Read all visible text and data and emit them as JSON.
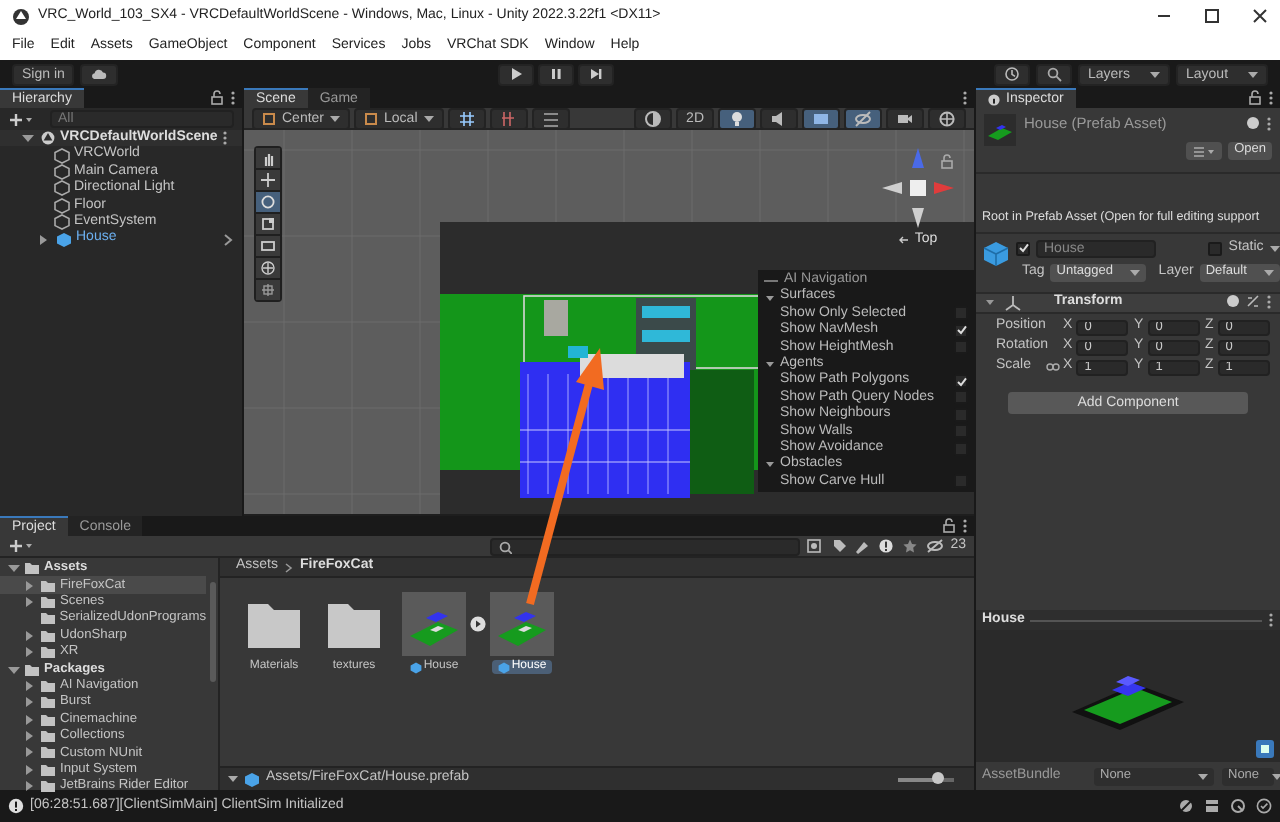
{
  "window": {
    "title": "VRC_World_103_SX4 - VRCDefaultWorldScene - Windows, Mac, Linux - Unity 2022.3.22f1 <DX11>"
  },
  "menu": [
    "File",
    "Edit",
    "Assets",
    "GameObject",
    "Component",
    "Services",
    "Jobs",
    "VRChat SDK",
    "Window",
    "Help"
  ],
  "toolbar": {
    "sign_in": "Sign in",
    "layers": "Layers",
    "layout": "Layout"
  },
  "hierarchy": {
    "tab": "Hierarchy",
    "search_placeholder": "All",
    "scene": {
      "name": "VRCDefaultWorldScene",
      "expanded": true
    },
    "objects": [
      {
        "name": "VRCWorld",
        "kind": "object"
      },
      {
        "name": "Main Camera",
        "kind": "object"
      },
      {
        "name": "Directional Light",
        "kind": "object"
      },
      {
        "name": "Floor",
        "kind": "object"
      },
      {
        "name": "EventSystem",
        "kind": "object"
      },
      {
        "name": "House",
        "kind": "prefab"
      }
    ]
  },
  "scene_view": {
    "tabs": [
      {
        "label": "Scene",
        "selected": true
      },
      {
        "label": "Game",
        "selected": false
      }
    ],
    "pivot": "Center",
    "space": "Local",
    "mode_2d": "2D",
    "gizmo_label": "Top",
    "toggles": [
      {
        "kind": "lighting",
        "on": true
      },
      {
        "kind": "audio",
        "on": false
      },
      {
        "kind": "effects",
        "on": true
      },
      {
        "kind": "hidden",
        "on": true
      }
    ],
    "ai_navigation": {
      "title": "AI Navigation",
      "sections": [
        {
          "title": "Surfaces",
          "items": [
            {
              "label": "Show Only Selected",
              "checked": false
            },
            {
              "label": "Show NavMesh",
              "checked": true
            },
            {
              "label": "Show HeightMesh",
              "checked": false
            }
          ]
        },
        {
          "title": "Agents",
          "items": [
            {
              "label": "Show Path Polygons",
              "checked": true
            },
            {
              "label": "Show Path Query Nodes",
              "checked": false
            },
            {
              "label": "Show Neighbours",
              "checked": false
            },
            {
              "label": "Show Walls",
              "checked": false
            },
            {
              "label": "Show Avoidance",
              "checked": false
            }
          ]
        },
        {
          "title": "Obstacles",
          "items": [
            {
              "label": "Show Carve Hull",
              "checked": false
            }
          ]
        }
      ]
    }
  },
  "project": {
    "tabs": [
      {
        "label": "Project",
        "selected": true
      },
      {
        "label": "Console",
        "selected": false
      }
    ],
    "hidden_count": "23",
    "tree": [
      {
        "label": "Assets",
        "expandable": true,
        "expanded": true,
        "selected": false,
        "children": [
          {
            "label": "FireFoxCat",
            "expandable": true,
            "expanded": false,
            "selected": true
          },
          {
            "label": "Scenes",
            "expandable": true,
            "expanded": false,
            "selected": false
          },
          {
            "label": "SerializedUdonPrograms",
            "expandable": false,
            "expanded": false,
            "selected": false
          },
          {
            "label": "UdonSharp",
            "expandable": true,
            "expanded": false,
            "selected": false
          },
          {
            "label": "XR",
            "expandable": true,
            "expanded": false,
            "selected": false
          }
        ]
      },
      {
        "label": "Packages",
        "expandable": true,
        "expanded": true,
        "selected": false,
        "children": [
          {
            "label": "AI Navigation",
            "expandable": true,
            "expanded": false,
            "selected": false
          },
          {
            "label": "Burst",
            "expandable": true,
            "expanded": false,
            "selected": false
          },
          {
            "label": "Cinemachine",
            "expandable": true,
            "expanded": false,
            "selected": false
          },
          {
            "label": "Collections",
            "expandable": true,
            "expanded": false,
            "selected": false
          },
          {
            "label": "Custom NUnit",
            "expandable": true,
            "expanded": false,
            "selected": false
          },
          {
            "label": "Input System",
            "expandable": true,
            "expanded": false,
            "selected": false
          },
          {
            "label": "JetBrains Rider Editor",
            "expandable": true,
            "expanded": false,
            "selected": false
          }
        ]
      }
    ],
    "breadcrumb": [
      "Assets",
      "FireFoxCat"
    ],
    "assets": [
      {
        "kind": "folder",
        "label": "Materials",
        "selected": false
      },
      {
        "kind": "folder",
        "label": "textures",
        "selected": false
      },
      {
        "kind": "prefab",
        "label": "House",
        "selected": false
      },
      {
        "kind": "prefab",
        "label": "House",
        "selected": true
      }
    ],
    "selected_path": "Assets/FireFoxCat/House.prefab",
    "icon_size": {
      "level": 0.7
    }
  },
  "inspector": {
    "tab": "Inspector",
    "title": "House (Prefab Asset)",
    "open_button": "Open",
    "notice": "Root in Prefab Asset (Open for full editing support",
    "active": true,
    "name": "House",
    "static_label": "Static",
    "static": false,
    "tag_label": "Tag",
    "tag": "Untagged",
    "layer_label": "Layer",
    "layer": "Default",
    "transform": {
      "title": "Transform",
      "rows": [
        {
          "label": "Position",
          "kind": "vector",
          "fields": [
            {
              "axis": "X",
              "value": "0"
            },
            {
              "axis": "Y",
              "value": "0"
            },
            {
              "axis": "Z",
              "value": "0"
            }
          ]
        },
        {
          "label": "Rotation",
          "kind": "vector",
          "fields": [
            {
              "axis": "X",
              "value": "0"
            },
            {
              "axis": "Y",
              "value": "0"
            },
            {
              "axis": "Z",
              "value": "0"
            }
          ]
        },
        {
          "label": "Scale",
          "kind": "scale",
          "fields": [
            {
              "axis": "X",
              "value": "1"
            },
            {
              "axis": "Y",
              "value": "1"
            },
            {
              "axis": "Z",
              "value": "1"
            }
          ]
        }
      ]
    },
    "add_component": "Add Component",
    "preview_title": "House",
    "asset_bundle_label": "AssetBundle",
    "asset_bundle": "None",
    "asset_bundle_variant": "None"
  },
  "status_bar": {
    "message": "[06:28:51.687][ClientSimMain] ClientSim Initialized"
  }
}
